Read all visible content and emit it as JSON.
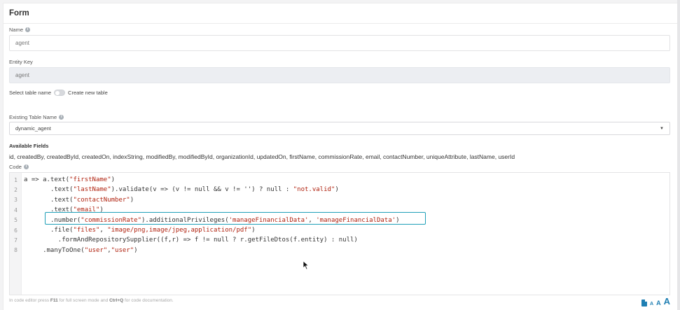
{
  "form": {
    "title": "Form",
    "name_label": "Name",
    "name_value": "agent",
    "entity_key_label": "Entity Key",
    "entity_key_value": "agent",
    "toggle_left_label": "Select table name",
    "toggle_right_label": "Create new table",
    "existing_table_label": "Existing Table Name",
    "existing_table_value": "dynamic_agent",
    "available_fields_label": "Available Fields",
    "available_fields": "id, createdBy, createdById, createdOn, indexString, modifiedBy, modifiedById, organizationId, updatedOn, firstName, commissionRate, email, contactNumber, uniqueAttribute, lastName, userId",
    "code_label": "Code"
  },
  "editor": {
    "lines": [
      {
        "num": "1",
        "indent": "",
        "parts": [
          {
            "t": "a => a.text("
          },
          {
            "t": "\"firstName\"",
            "s": true
          },
          {
            "t": ")"
          }
        ]
      },
      {
        "num": "2",
        "indent": "       ",
        "parts": [
          {
            "t": ".text("
          },
          {
            "t": "\"lastName\"",
            "s": true
          },
          {
            "t": ").validate(v => (v != null && v != '') ? null : "
          },
          {
            "t": "\"not.valid\"",
            "s": true
          },
          {
            "t": ")"
          }
        ]
      },
      {
        "num": "3",
        "indent": "       ",
        "parts": [
          {
            "t": ".text("
          },
          {
            "t": "\"contactNumber\"",
            "s": true
          },
          {
            "t": ")"
          }
        ]
      },
      {
        "num": "4",
        "indent": "       ",
        "parts": [
          {
            "t": ".text("
          },
          {
            "t": "\"email\"",
            "s": true
          },
          {
            "t": ")"
          }
        ]
      },
      {
        "num": "5",
        "indent": "       ",
        "parts": [
          {
            "t": ".number("
          },
          {
            "t": "\"commissionRate\"",
            "s": true
          },
          {
            "t": ").additionalPrivileges("
          },
          {
            "t": "'manageFinancialData'",
            "s": true
          },
          {
            "t": ", "
          },
          {
            "t": "'manageFinancialData'",
            "s": true
          },
          {
            "t": ")"
          }
        ]
      },
      {
        "num": "6",
        "indent": "       ",
        "parts": [
          {
            "t": ".file("
          },
          {
            "t": "\"files\"",
            "s": true
          },
          {
            "t": ", "
          },
          {
            "t": "\"image/png,image/jpeg,application/pdf\"",
            "s": true
          },
          {
            "t": ")"
          }
        ]
      },
      {
        "num": "7",
        "indent": "         ",
        "parts": [
          {
            "t": ".formAndRepositorySupplier((f,r) => f != null ? r.getFileDtos(f.entity) : null)"
          }
        ]
      },
      {
        "num": "8",
        "indent": "     ",
        "parts": [
          {
            "t": ".manyToOne("
          },
          {
            "t": "\"user\"",
            "s": true
          },
          {
            "t": ","
          },
          {
            "t": "\"user\"",
            "s": true
          },
          {
            "t": ")"
          }
        ]
      }
    ]
  },
  "footer": {
    "hint_prefix": "In code editor press ",
    "hint_key1": "F11",
    "hint_mid": " for full screen mode and ",
    "hint_key2": "Ctrl+Q",
    "hint_suffix": " for code documentation.",
    "font_small": "A",
    "font_mid": "A",
    "font_big": "A"
  },
  "colors": {
    "highlight": "#1fa0b8",
    "string": "#b0220f",
    "accent": "#1f7fb3"
  }
}
